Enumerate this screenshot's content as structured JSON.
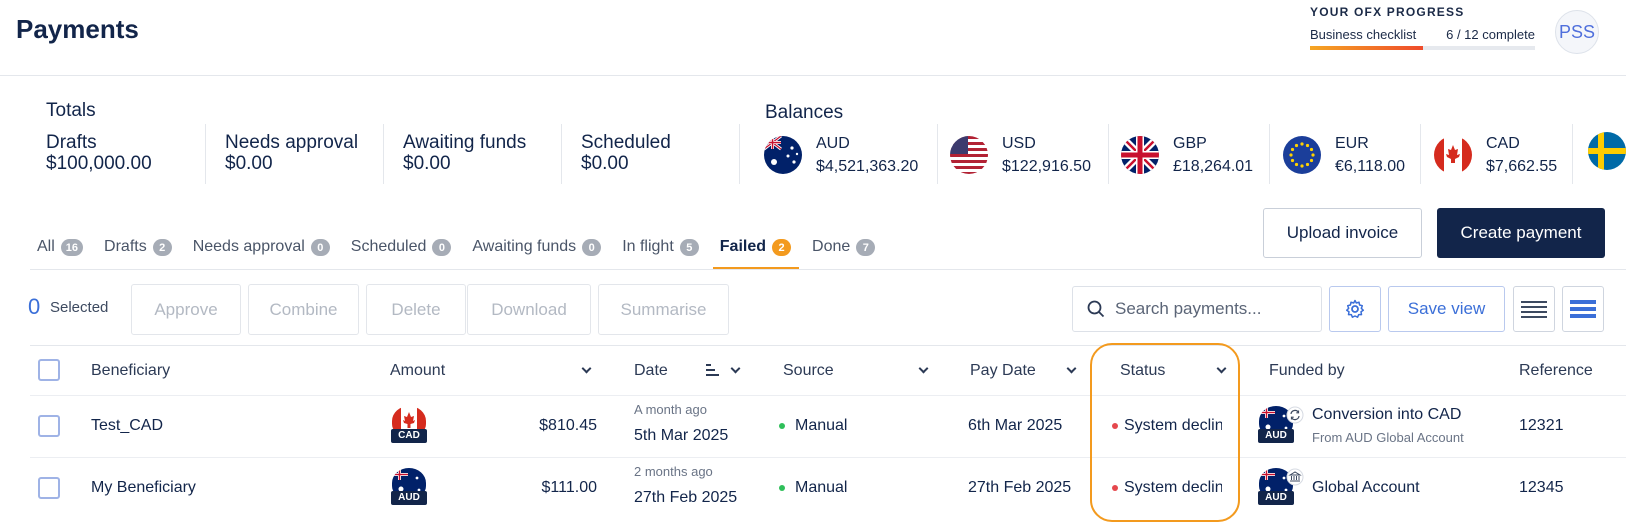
{
  "header": {
    "title": "Payments",
    "progress": {
      "heading": "YOUR OFX PROGRESS",
      "label": "Business checklist",
      "count": "6 / 12 complete",
      "fraction": 0.5
    },
    "avatar": "PSS"
  },
  "totals": {
    "title": "Totals",
    "items": [
      {
        "label": "Drafts",
        "value": "$100,000.00"
      },
      {
        "label": "Needs approval",
        "value": "$0.00"
      },
      {
        "label": "Awaiting funds",
        "value": "$0.00"
      },
      {
        "label": "Scheduled",
        "value": "$0.00"
      }
    ]
  },
  "balances": {
    "title": "Balances",
    "items": [
      {
        "currency": "AUD",
        "amount": "$4,521,363.20",
        "flag": "au-flag"
      },
      {
        "currency": "USD",
        "amount": "$122,916.50",
        "flag": "us-flag"
      },
      {
        "currency": "GBP",
        "amount": "£18,264.01",
        "flag": "gb-flag"
      },
      {
        "currency": "EUR",
        "amount": "€6,118.00",
        "flag": "eu-flag"
      },
      {
        "currency": "CAD",
        "amount": "$7,662.55",
        "flag": "ca-flag"
      }
    ]
  },
  "actions": {
    "upload": "Upload invoice",
    "create": "Create payment"
  },
  "tabs": [
    {
      "label": "All",
      "count": "16"
    },
    {
      "label": "Drafts",
      "count": "2"
    },
    {
      "label": "Needs approval",
      "count": "0"
    },
    {
      "label": "Scheduled",
      "count": "0"
    },
    {
      "label": "Awaiting funds",
      "count": "0"
    },
    {
      "label": "In flight",
      "count": "5"
    },
    {
      "label": "Failed",
      "count": "2",
      "active": true
    },
    {
      "label": "Done",
      "count": "7"
    }
  ],
  "toolbar": {
    "selected_count": "0",
    "selected_label": "Selected",
    "buttons": [
      "Approve",
      "Combine",
      "Delete",
      "Download",
      "Summarise"
    ],
    "search_placeholder": "Search payments...",
    "save_view": "Save view"
  },
  "table": {
    "columns": [
      "Beneficiary",
      "Amount",
      "Date",
      "Source",
      "Pay Date",
      "Status",
      "Funded by",
      "Reference"
    ],
    "rows": [
      {
        "beneficiary": "Test_CAD",
        "currency_label": "CAD",
        "amount": "$810.45",
        "date_relative": "A month ago",
        "date": "5th Mar 2025",
        "source": "Manual",
        "pay_date": "6th Mar 2025",
        "status": "System declined",
        "funded_currency": "AUD",
        "funded_by": "Conversion into CAD",
        "funded_sub": "From AUD Global Account",
        "reference": "12321"
      },
      {
        "beneficiary": "My Beneficiary",
        "currency_label": "AUD",
        "amount": "$111.00",
        "date_relative": "2 months ago",
        "date": "27th Feb 2025",
        "source": "Manual",
        "pay_date": "27th Feb 2025",
        "status": "System declined",
        "funded_currency": "AUD",
        "funded_by": "Global Account",
        "funded_sub": "",
        "reference": "12345"
      }
    ]
  },
  "colors": {
    "accent": "#3b6fd8",
    "navy": "#12254a",
    "highlight": "#f39a1e",
    "status_dot": "#e5484d",
    "source_dot": "#2fbf5a"
  }
}
